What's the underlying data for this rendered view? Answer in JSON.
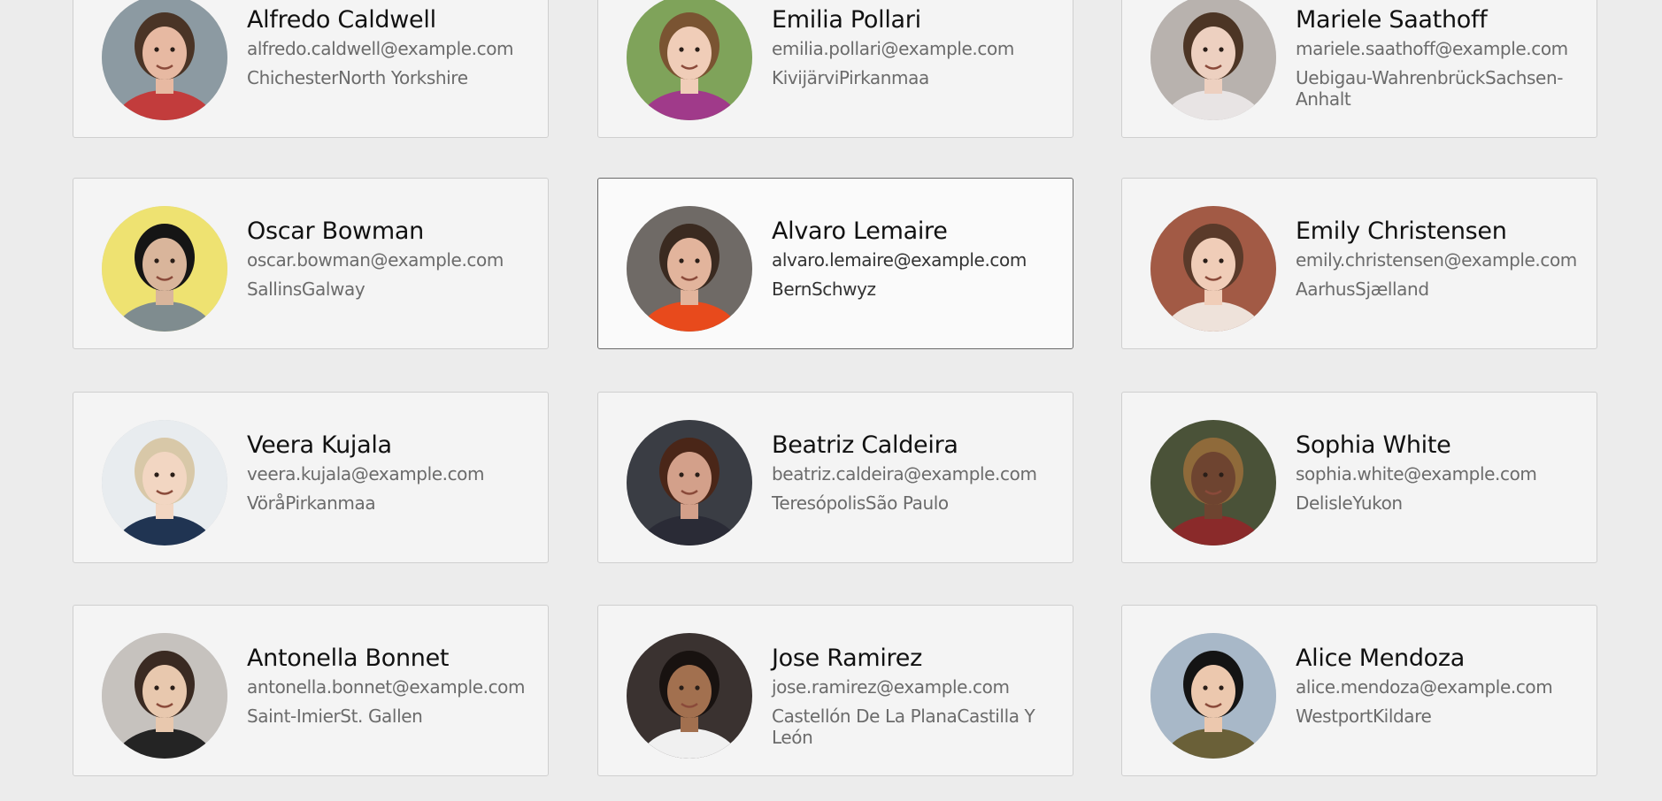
{
  "users": [
    {
      "name": "Alfredo Caldwell",
      "email": "alfredo.caldwell@example.com",
      "location": "ChichesterNorth Yorkshire",
      "avatar_colors": {
        "bg": "#8c9aa2",
        "skin": "#e7b9a2",
        "hair": "#4a3426",
        "shirt": "#c23c3c"
      }
    },
    {
      "name": "Emilia Pollari",
      "email": "emilia.pollari@example.com",
      "location": "KivijärviPirkanmaa",
      "avatar_colors": {
        "bg": "#7fa35a",
        "skin": "#f0cdb8",
        "hair": "#7a5432",
        "shirt": "#a03a8a"
      }
    },
    {
      "name": "Mariele Saathoff",
      "email": "mariele.saathoff@example.com",
      "location": "Uebigau-WahrenbrückSachsen-Anhalt",
      "avatar_colors": {
        "bg": "#b8b2ae",
        "skin": "#edd0c0",
        "hair": "#4c3525",
        "shirt": "#e8e4e4"
      }
    },
    {
      "name": "Oscar Bowman",
      "email": "oscar.bowman@example.com",
      "location": "SallinsGalway",
      "avatar_colors": {
        "bg": "#eee271",
        "skin": "#d9b59b",
        "hair": "#151515",
        "shirt": "#7f8c8f"
      }
    },
    {
      "name": "Alvaro Lemaire",
      "email": "alvaro.lemaire@example.com",
      "location": "BernSchwyz",
      "avatar_colors": {
        "bg": "#6f6a66",
        "skin": "#e2b49c",
        "hair": "#3a2a20",
        "shirt": "#e84a1c"
      }
    },
    {
      "name": "Emily Christensen",
      "email": "emily.christensen@example.com",
      "location": "AarhusSjælland",
      "avatar_colors": {
        "bg": "#a25a45",
        "skin": "#f0cdb8",
        "hair": "#5a3a2a",
        "shirt": "#eee2da"
      }
    },
    {
      "name": "Veera Kujala",
      "email": "veera.kujala@example.com",
      "location": "VöråPirkanmaa",
      "avatar_colors": {
        "bg": "#e8ecef",
        "skin": "#f2d6c2",
        "hair": "#d8c8a8",
        "shirt": "#203452"
      }
    },
    {
      "name": "Beatriz Caldeira",
      "email": "beatriz.caldeira@example.com",
      "location": "TeresópolisSão Paulo",
      "avatar_colors": {
        "bg": "#3a3d44",
        "skin": "#d3a08a",
        "hair": "#4a2618",
        "shirt": "#2a2b36"
      }
    },
    {
      "name": "Sophia White",
      "email": "sophia.white@example.com",
      "location": "DelisleYukon",
      "avatar_colors": {
        "bg": "#4a5238",
        "skin": "#6e4430",
        "hair": "#8f6a3a",
        "shirt": "#8a2a2a"
      }
    },
    {
      "name": "Antonella Bonnet",
      "email": "antonella.bonnet@example.com",
      "location": "Saint-ImierSt. Gallen",
      "avatar_colors": {
        "bg": "#c6c2be",
        "skin": "#e8c8ae",
        "hair": "#3a2a22",
        "shirt": "#242424"
      }
    },
    {
      "name": "Jose Ramirez",
      "email": "jose.ramirez@example.com",
      "location": "Castellón De La PlanaCastilla Y León",
      "avatar_colors": {
        "bg": "#3a3230",
        "skin": "#a2704f",
        "hair": "#181210",
        "shirt": "#f0f0f0"
      }
    },
    {
      "name": "Alice Mendoza",
      "email": "alice.mendoza@example.com",
      "location": "WestportKildare",
      "avatar_colors": {
        "bg": "#a8b8c8",
        "skin": "#ecc8ae",
        "hair": "#141414",
        "shirt": "#6a6038"
      }
    }
  ]
}
